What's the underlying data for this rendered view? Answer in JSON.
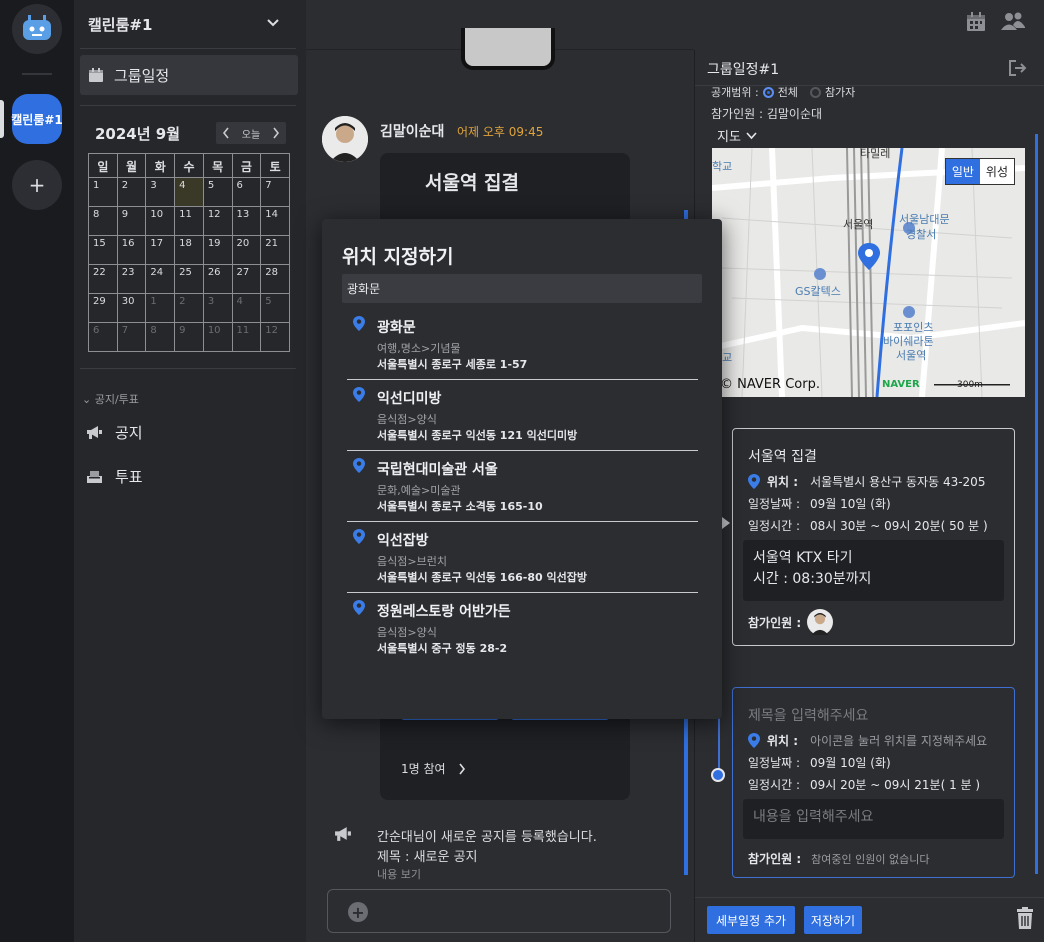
{
  "rail": {
    "room_label": "캘린룸#1",
    "add_label": "+"
  },
  "sidebar": {
    "room_title": "캘린룸#1",
    "nav_group": "그룹일정",
    "calendar": {
      "title": "2024년 9월",
      "today_label": "오늘",
      "weekdays": [
        "일",
        "월",
        "화",
        "수",
        "목",
        "금",
        "토"
      ],
      "weeks": [
        [
          "1",
          "2",
          "3",
          "4",
          "5",
          "6",
          "7"
        ],
        [
          "8",
          "9",
          "10",
          "11",
          "12",
          "13",
          "14"
        ],
        [
          "15",
          "16",
          "17",
          "18",
          "19",
          "20",
          "21"
        ],
        [
          "22",
          "23",
          "24",
          "25",
          "26",
          "27",
          "28"
        ],
        [
          "29",
          "30",
          "1",
          "2",
          "3",
          "4",
          "5"
        ],
        [
          "6",
          "7",
          "8",
          "9",
          "10",
          "11",
          "12"
        ]
      ]
    },
    "section_label": "공지/투표",
    "notice": "공지",
    "vote": "투표"
  },
  "chat": {
    "sender": "김말이순대",
    "time": "어제 오후 09:45",
    "card_title": "서울역 집결",
    "card_join": "1명 참여",
    "notice_line1": "간순대님이 새로운 공지를 등록했습니다.",
    "notice_line2": "제목 : 새로운 공지",
    "notice_line3": "내용 보기"
  },
  "modal": {
    "title": "위치 지정하기",
    "search_value": "광화문",
    "places": [
      {
        "name": "광화문",
        "category": "여행,명소>기념물",
        "address": "서울특별시 종로구 세종로 1-57"
      },
      {
        "name": "익선디미방",
        "category": "음식점>양식",
        "address": "서울특별시 종로구 익선동 121 익선디미방"
      },
      {
        "name": "국립현대미술관 서울",
        "category": "문화,예술>미술관",
        "address": "서울특별시 종로구 소격동 165-10"
      },
      {
        "name": "익선잡방",
        "category": "음식점>브런치",
        "address": "서울특별시 종로구 익선동 166-80 익선잡방"
      },
      {
        "name": "정원레스토랑 어반가든",
        "category": "음식점>양식",
        "address": "서울특별시 중구 정동 28-2"
      }
    ]
  },
  "panel": {
    "title": "그룹일정#1",
    "visibility_label": "공개범위 :",
    "visibility_all": "전체",
    "visibility_participants": "참가자",
    "participants_row": "참가인원 : 김말이순대",
    "map_toggle": "지도",
    "map": {
      "btn_normal": "일반",
      "btn_satellite": "위성",
      "copyright": "© NAVER Corp.",
      "brand": "NAVER",
      "scale": "300m",
      "labels": [
        "서울역",
        "서울남대문",
        "경찰서",
        "GS칼텍스",
        "포포인츠",
        "바이쉐라톤",
        "서울역",
        "학교",
        "학교",
        "타밀레"
      ]
    },
    "card1": {
      "title": "서울역 집결",
      "location_label": "위치 :",
      "location_value": "서울특별시 용산구 동자동 43-205",
      "date_label": "일정날짜 :",
      "date_value": "09월 10일 (화)",
      "time_label": "일정시간 :",
      "time_value": "08시 30분 ~ 09시 20분( 50 분 )",
      "memo_line1": "서울역 KTX 타기",
      "memo_line2": "시간 : 08:30분까지",
      "participants_label": "참가인원 :"
    },
    "card2": {
      "title_placeholder": "제목을 입력해주세요",
      "location_label": "위치 :",
      "location_placeholder": "아이콘을 눌러 위치를 지정해주세요",
      "date_label": "일정날짜 :",
      "date_value": "09월 10일 (화)",
      "time_label": "일정시간 :",
      "time_value": "09시 20분 ~ 09시 21분( 1 분 )",
      "memo_placeholder": "내용을 입력해주세요",
      "participants_label": "참가인원 :",
      "participants_empty": "참여중인 인원이 없습니다"
    },
    "add_detail_btn": "세부일정 추가",
    "save_btn": "저장하기"
  },
  "colors": {
    "accent": "#2f6fe0",
    "today": "#e0a43a"
  }
}
